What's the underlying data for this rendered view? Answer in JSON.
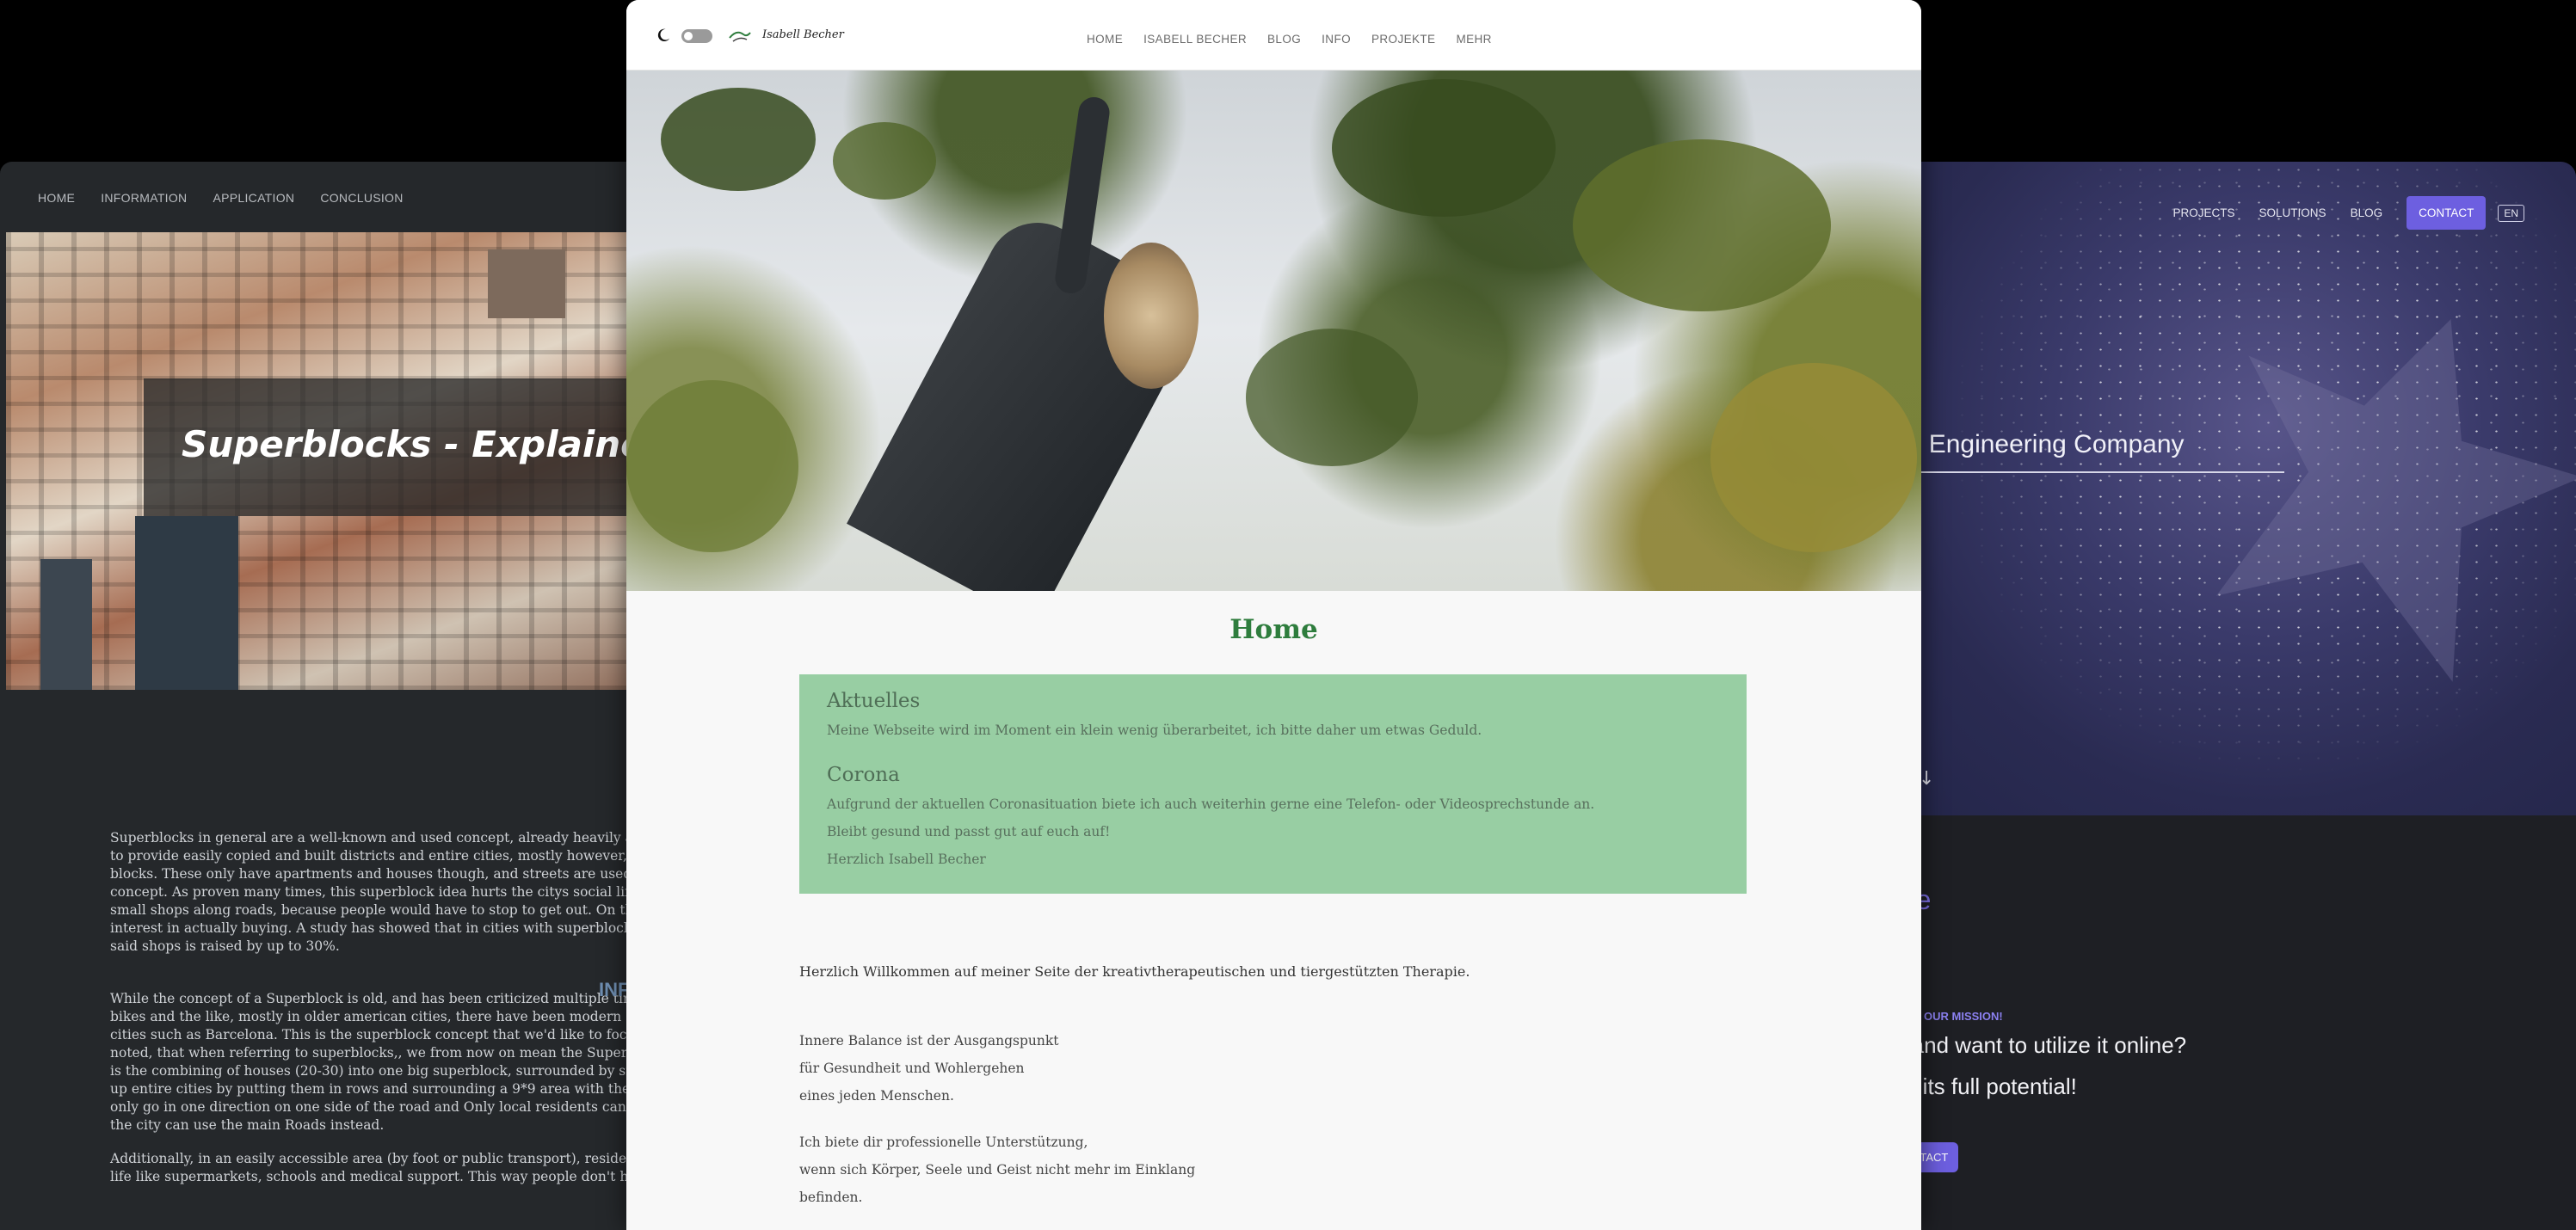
{
  "left": {
    "nav": [
      "HOME",
      "INFORMATION",
      "APPLICATION",
      "CONCLUSION"
    ],
    "hero_title": "Superblocks - Explained",
    "section_heading": "INF",
    "paragraphs": [
      "Superblocks in general are a well-known and used concept, already heavily app to provide easily copied and built districts and entire cities, mostly however, the blocks. These only have apartments and houses though, and streets are used by concept. As proven many times, this superblock idea hurts the citys social life m small shops along roads, because people would have to stop to get out. On the ot interest in actually buying. A study has showed that in cities with superblocks l said shops is raised by up to 30%.",
      "While the concept of a Superblock is old, and has been criticized multiple times bikes and the like, mostly in older american cities, there have been modern atte cities such as Barcelona. This is the superblock concept that we'd like to focus o noted, that when referring to superblocks,, we from now on mean the Superilles is the combining of houses (20-30) into one big superblock, surrounded by small up entire cities by putting them in rows and surrounding a 9*9 area with the ma only go in one direction on one side of the road and Only local residents can driv the city can use the main Roads instead.",
      "Additionally, in an easily accessible area (by foot or public transport), residents life like supermarkets, schools and medical support. This way people don't have"
    ]
  },
  "center": {
    "logo_text": "Isabell Becher",
    "nav": [
      "HOME",
      "ISABELL BECHER",
      "BLOG",
      "INFO",
      "PROJEKTE",
      "MEHR"
    ],
    "page_title": "Home",
    "notice": {
      "heading1": "Aktuelles",
      "text1": "Meine Webseite wird im Moment ein klein wenig überarbeitet, ich bitte daher um etwas Geduld.",
      "heading2": "Corona",
      "text2": "Aufgrund der aktuellen Coronasituation biete ich auch weiterhin gerne eine Telefon- oder Videosprechstunde an.",
      "text3": "Bleibt gesund und passt gut auf euch auf!",
      "text4": "Herzlich Isabell Becher"
    },
    "welcome": "Herzlich Willkommen auf meiner Seite der kreativtherapeutischen und tiergestützten Therapie.",
    "para1": [
      "Innere Balance ist der Ausgangspunkt",
      "für Gesundheit und Wohlergehen",
      "eines jeden Menschen."
    ],
    "para2": [
      "Ich biete dir professionelle Unterstützung,",
      "wenn sich Körper, Seele und Geist nicht mehr im Einklang",
      "befinden."
    ]
  },
  "right": {
    "nav": [
      "PROJECTS",
      "SOLUTIONS",
      "BLOG"
    ],
    "contact_label": "CONTACT",
    "lang_label": "EN",
    "hero_title": "eb Engineering Company",
    "arrow": "↓",
    "home_title": "me",
    "mission_label": "OUR MISSION!",
    "line1": "a and want to utilize it online?",
    "line2": "ch its full potential!",
    "contact2_label": "NTACT"
  },
  "colors": {
    "center_title": "#2e7d3d",
    "notice_bg": "#98cea3",
    "right_accent": "#6d5fe0"
  }
}
